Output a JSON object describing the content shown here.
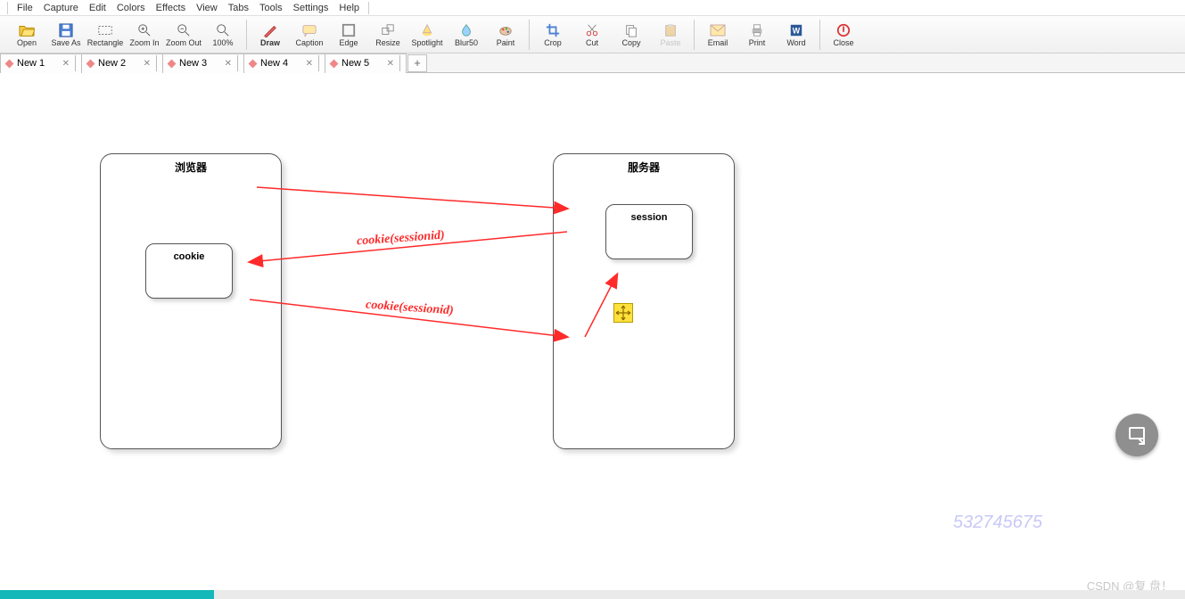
{
  "menu": {
    "items": [
      "File",
      "Capture",
      "Edit",
      "Colors",
      "Effects",
      "View",
      "Tabs",
      "Tools",
      "Settings",
      "Help"
    ]
  },
  "toolbar": [
    {
      "label": "Open",
      "name": "open-button"
    },
    {
      "label": "Save As",
      "name": "saveas-button"
    },
    {
      "label": "Rectangle",
      "name": "rectangle-button"
    },
    {
      "label": "Zoom In",
      "name": "zoomin-button"
    },
    {
      "label": "Zoom Out",
      "name": "zoomout-button"
    },
    {
      "label": "100%",
      "name": "zoom100-button"
    },
    {
      "sep": true
    },
    {
      "label": "Draw",
      "name": "draw-button",
      "bold": true
    },
    {
      "label": "Caption",
      "name": "caption-button"
    },
    {
      "label": "Edge",
      "name": "edge-button"
    },
    {
      "label": "Resize",
      "name": "resize-button"
    },
    {
      "label": "Spotlight",
      "name": "spotlight-button"
    },
    {
      "label": "Blur50",
      "name": "blur-button"
    },
    {
      "label": "Paint",
      "name": "paint-button"
    },
    {
      "sep": true
    },
    {
      "label": "Crop",
      "name": "crop-button"
    },
    {
      "label": "Cut",
      "name": "cut-button"
    },
    {
      "label": "Copy",
      "name": "copy-button"
    },
    {
      "label": "Paste",
      "name": "paste-button",
      "disabled": true
    },
    {
      "sep": true
    },
    {
      "label": "Email",
      "name": "email-button"
    },
    {
      "label": "Print",
      "name": "print-button"
    },
    {
      "label": "Word",
      "name": "word-button"
    },
    {
      "sep": true
    },
    {
      "label": "Close",
      "name": "close-button"
    }
  ],
  "tabs": [
    {
      "label": "New 1"
    },
    {
      "label": "New 2"
    },
    {
      "label": "New 3"
    },
    {
      "label": "New 4"
    },
    {
      "label": "New 5"
    }
  ],
  "diagram": {
    "browser_title": "浏览器",
    "server_title": "服务器",
    "cookie_label": "cookie",
    "session_label": "session",
    "arrow_label_1": "cookie(sessionid)",
    "arrow_label_2": "cookie(sessionid)"
  },
  "watermarks": {
    "number": "532745675",
    "csdn": "CSDN @复 盘！"
  }
}
